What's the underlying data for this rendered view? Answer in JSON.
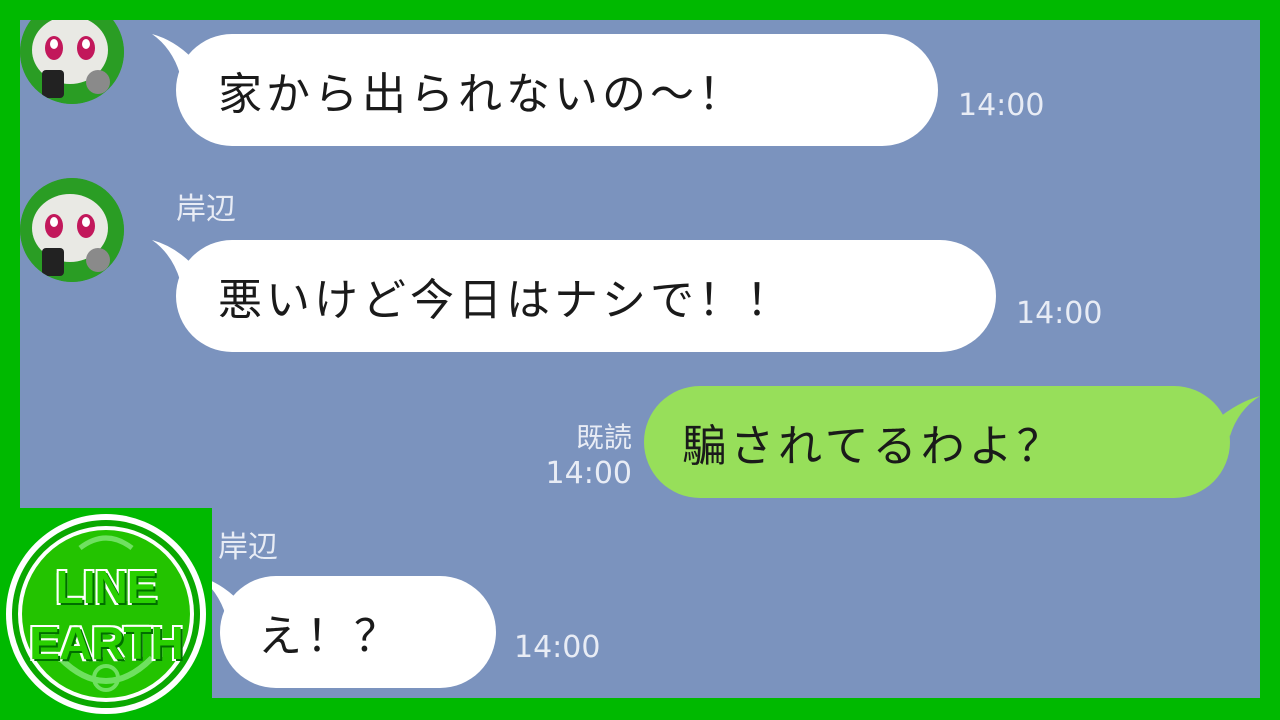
{
  "messages": [
    {
      "sender": "",
      "text": "家から出られないの〜！",
      "time": "14:00"
    },
    {
      "sender": "岸辺",
      "text": "悪いけど今日はナシで！！",
      "time": "14:00"
    },
    {
      "read_label": "既読",
      "time": "14:00",
      "text": "騙されてるわよ？"
    },
    {
      "sender": "岸辺",
      "text": "え！？",
      "time": "14:00"
    }
  ],
  "logo": {
    "line1": "LINE",
    "line2": "EARTH"
  },
  "colors": {
    "frame": "#00b900",
    "chat_background": "#7b93be",
    "incoming_bubble": "#ffffff",
    "outgoing_bubble": "#97df5a",
    "logo_green": "#29d000"
  },
  "icons": {
    "avatar": "cartoon-character-with-phone-icon",
    "logo": "line-earth-logo-icon"
  }
}
